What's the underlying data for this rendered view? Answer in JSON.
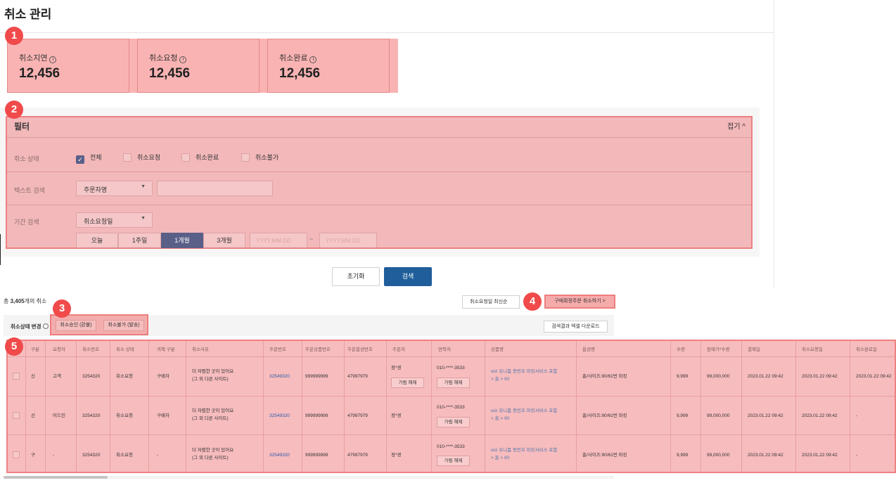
{
  "page_title": "취소 관리",
  "badges": [
    "1",
    "2",
    "3",
    "4",
    "5"
  ],
  "stats": [
    {
      "label": "취소지연",
      "info": "i",
      "value": "12,456"
    },
    {
      "label": "취소요청",
      "info": "i",
      "value": "12,456"
    },
    {
      "label": "취소완료",
      "info": "i",
      "value": "12,456"
    }
  ],
  "filter": {
    "title": "필터",
    "fold_label": "접기 ^",
    "status_label": "취소 상태",
    "statuses": [
      {
        "label": "전체",
        "checked": true
      },
      {
        "label": "취소요청",
        "checked": false
      },
      {
        "label": "취소완료",
        "checked": false
      },
      {
        "label": "취소불가",
        "checked": false
      }
    ],
    "text_search_label": "텍스트 검색",
    "text_search_select": "주문자명",
    "text_search_value": "",
    "period_label": "기간 검색",
    "period_select": "취소요청일",
    "periods": [
      {
        "label": "오늘",
        "active": false
      },
      {
        "label": "1주일",
        "active": false
      },
      {
        "label": "1개월",
        "active": true
      },
      {
        "label": "3개월",
        "active": false
      }
    ],
    "date_placeholder": "YYYY.MM.DD",
    "tilde": "~"
  },
  "actions": {
    "reset": "초기화",
    "search": "검색"
  },
  "results": {
    "total_prefix": "총 ",
    "total_count": "3,405",
    "total_suffix": "개의 취소",
    "sort_select": "취소요청일 최신순",
    "force_cancel_btn": "구매확정주문 취소하기 >",
    "status_change_label": "취소상태 변경",
    "approve_btn": "취소승인 (환불)",
    "reject_btn": "취소불가 (발송)",
    "excel_btn": "검색결과 엑셀 다운로드"
  },
  "table": {
    "columns": [
      "구분",
      "요청자",
      "취소번호",
      "취소 상태",
      "귀책 구분",
      "취소사유",
      "주문번호",
      "주문상품번호",
      "주문옵션번호",
      "주문자",
      "연락처",
      "상품명",
      "옵션명",
      "수량",
      "판매가*수량",
      "결제일",
      "취소요청일",
      "취소완료일"
    ],
    "rows": [
      {
        "type": "신",
        "requester": "고객",
        "cancel_no": "3254320",
        "status": "취소요청",
        "fault": "구매자",
        "reason1": "더 저렴한 곳이 있어요",
        "reason2": "(그 외 다른 사이트)",
        "order_no": "32549320",
        "product_order_no": "999999999",
        "option_order_no": "47997979",
        "orderer": "정*경",
        "orderer_btn": "가림 해제",
        "phone": "010-****-3533",
        "phone_btn": "가림 해제",
        "product1": "wiz 유니폼 등번호 마킹서비스 포함",
        "product2": "> 홈 > 90",
        "option": "홈/사이즈:90/61번 마킹",
        "qty": "9,999",
        "amount": "99,000,000",
        "paid": "2023.01.22 09:42",
        "requested": "2023.01.22 09:42",
        "completed": "2023.01.22 09:42"
      },
      {
        "type": "신",
        "requester": "어드민",
        "cancel_no": "3254320",
        "status": "취소요청",
        "fault": "구매자",
        "reason1": "더 저렴한 곳이 있어요",
        "reason2": "(그 외 다른 사이트)",
        "order_no": "32549320",
        "product_order_no": "999999999",
        "option_order_no": "47997979",
        "orderer": "정*경",
        "orderer_btn": "",
        "phone": "010-****-3533",
        "phone_btn": "가림 해제",
        "product1": "wiz 유니폼 등번호 마킹서비스 포함",
        "product2": "> 홈 > 90",
        "option": "홈/사이즈:90/61번 마킹",
        "qty": "9,999",
        "amount": "99,000,000",
        "paid": "2023.01.22 09:42",
        "requested": "2023.01.22 09:42",
        "completed": "-"
      },
      {
        "type": "구",
        "requester": "-",
        "cancel_no": "3254320",
        "status": "취소요청",
        "fault": "-",
        "reason1": "더 저렴한 곳이 있어요",
        "reason2": "(그 외 다른 사이트)",
        "order_no": "32549320",
        "product_order_no": "999999999",
        "option_order_no": "47997979",
        "orderer": "정*경",
        "orderer_btn": "",
        "phone": "010-****-3533",
        "phone_btn": "가림 해제",
        "product1": "wiz 유니폼 등번호 마킹서비스 포함",
        "product2": "> 홈 > 90",
        "option": "홈/사이즈:90/61번 마킹",
        "qty": "9,999",
        "amount": "99,000,000",
        "paid": "2023.01.22 09:42",
        "requested": "2023.01.22 09:42",
        "completed": "-"
      }
    ]
  },
  "colors": {
    "accent": "#1f5e9a",
    "active_chip": "#5a5f88",
    "highlight": "#f47878",
    "badge": "#f04a4a"
  }
}
